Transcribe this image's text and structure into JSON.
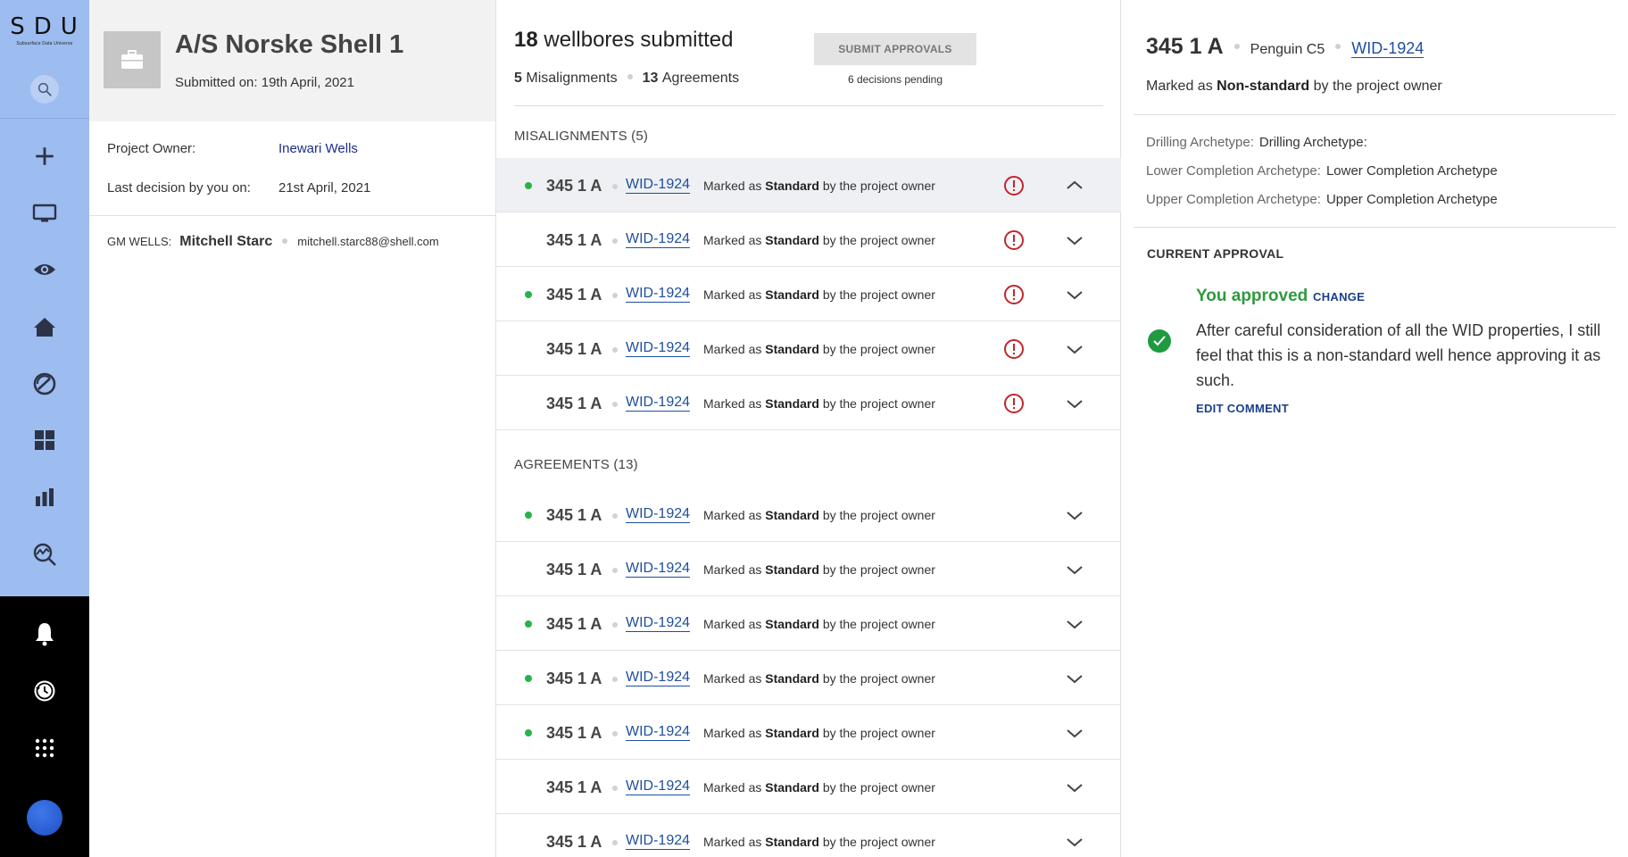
{
  "nav": {
    "logo": "SDU",
    "logo_sub": "Subsurface Data Universe",
    "colors": {
      "top": "#9dbcf0",
      "bottom": "#000000",
      "avatar": "#2f63da"
    },
    "icons": [
      "search-icon",
      "plus-icon",
      "monitor-icon",
      "eye-icon",
      "home-icon",
      "gauge-icon",
      "dashboard-icon",
      "bar-chart-icon",
      "analytics-icon",
      "bell-icon",
      "history-icon",
      "apps-grid-icon"
    ]
  },
  "project": {
    "title": "A/S Norske Shell 1",
    "submitted": "Submitted on: 19th April, 2021",
    "owner_label": "Project Owner:",
    "owner_value": "Inewari Wells",
    "last_decision_label": "Last decision by you on:",
    "last_decision_value": "21st April, 2021",
    "gm_label": "GM WELLS:",
    "gm_name": "Mitchell Starc",
    "gm_email": "mitchell.starc88@shell.com"
  },
  "summary": {
    "count": "18",
    "title": "wellbores submitted",
    "misalign_count": "5",
    "misalign_label": "Misalignments",
    "agree_count": "13",
    "agree_label": "Agreements",
    "submit_label": "SUBMIT APPROVALS",
    "pending": "6 decisions pending"
  },
  "misalignments": {
    "label": "MISALIGNMENTS (5)",
    "rows": [
      {
        "id": "345 1 A",
        "wid": "WID-1924",
        "prefix": "Marked as",
        "status": "Standard",
        "suffix": "by the project owner",
        "dot": true,
        "active": true,
        "expanded": true
      },
      {
        "id": "345 1 A",
        "wid": "WID-1924",
        "prefix": "Marked as",
        "status": "Standard",
        "suffix": "by the project owner",
        "dot": false
      },
      {
        "id": "345 1 A",
        "wid": "WID-1924",
        "prefix": "Marked as",
        "status": "Standard",
        "suffix": "by the project owner",
        "dot": true
      },
      {
        "id": "345 1 A",
        "wid": "WID-1924",
        "prefix": "Marked as",
        "status": "Standard",
        "suffix": "by the project owner",
        "dot": false
      },
      {
        "id": "345 1 A",
        "wid": "WID-1924",
        "prefix": "Marked as",
        "status": "Standard",
        "suffix": "by the project owner",
        "dot": false
      }
    ]
  },
  "agreements": {
    "label": "AGREEMENTS (13)",
    "rows": [
      {
        "id": "345 1 A",
        "wid": "WID-1924",
        "prefix": "Marked as",
        "status": "Standard",
        "suffix": "by the project owner",
        "dot": true
      },
      {
        "id": "345 1 A",
        "wid": "WID-1924",
        "prefix": "Marked as",
        "status": "Standard",
        "suffix": "by the project owner",
        "dot": false
      },
      {
        "id": "345 1 A",
        "wid": "WID-1924",
        "prefix": "Marked as",
        "status": "Standard",
        "suffix": "by the project owner",
        "dot": true
      },
      {
        "id": "345 1 A",
        "wid": "WID-1924",
        "prefix": "Marked as",
        "status": "Standard",
        "suffix": "by the project owner",
        "dot": true
      },
      {
        "id": "345 1 A",
        "wid": "WID-1924",
        "prefix": "Marked as",
        "status": "Standard",
        "suffix": "by the project owner",
        "dot": true
      },
      {
        "id": "345 1 A",
        "wid": "WID-1924",
        "prefix": "Marked as",
        "status": "Standard",
        "suffix": "by the project owner",
        "dot": false
      },
      {
        "id": "345 1 A",
        "wid": "WID-1924",
        "prefix": "Marked as",
        "status": "Standard",
        "suffix": "by the project owner",
        "dot": false
      }
    ]
  },
  "detail": {
    "id": "345 1 A",
    "field": "Penguin C5",
    "wid": "WID-1924",
    "marked_prefix": "Marked as",
    "marked_status": "Non-standard",
    "marked_suffix": "by the project owner",
    "archetypes": [
      {
        "label": "Drilling Archetype:",
        "value": "Drilling Archetype:"
      },
      {
        "label": "Lower Completion Archetype:",
        "value": "Lower Completion Archetype"
      },
      {
        "label": "Upper Completion Archetype:",
        "value": "Upper Completion Archetype"
      }
    ],
    "current_label": "CURRENT APPROVAL",
    "approved_text": "You approved",
    "change_label": "CHANGE",
    "comment": "After careful consideration of all the WID properties, I still feel that this is a non-standard well hence approving it as such.",
    "edit_label": "EDIT COMMENT",
    "colors": {
      "approved": "#2f9a3f",
      "link": "#1a3f8c",
      "warn": "#c0272d",
      "dot": "#2ab24a"
    }
  }
}
